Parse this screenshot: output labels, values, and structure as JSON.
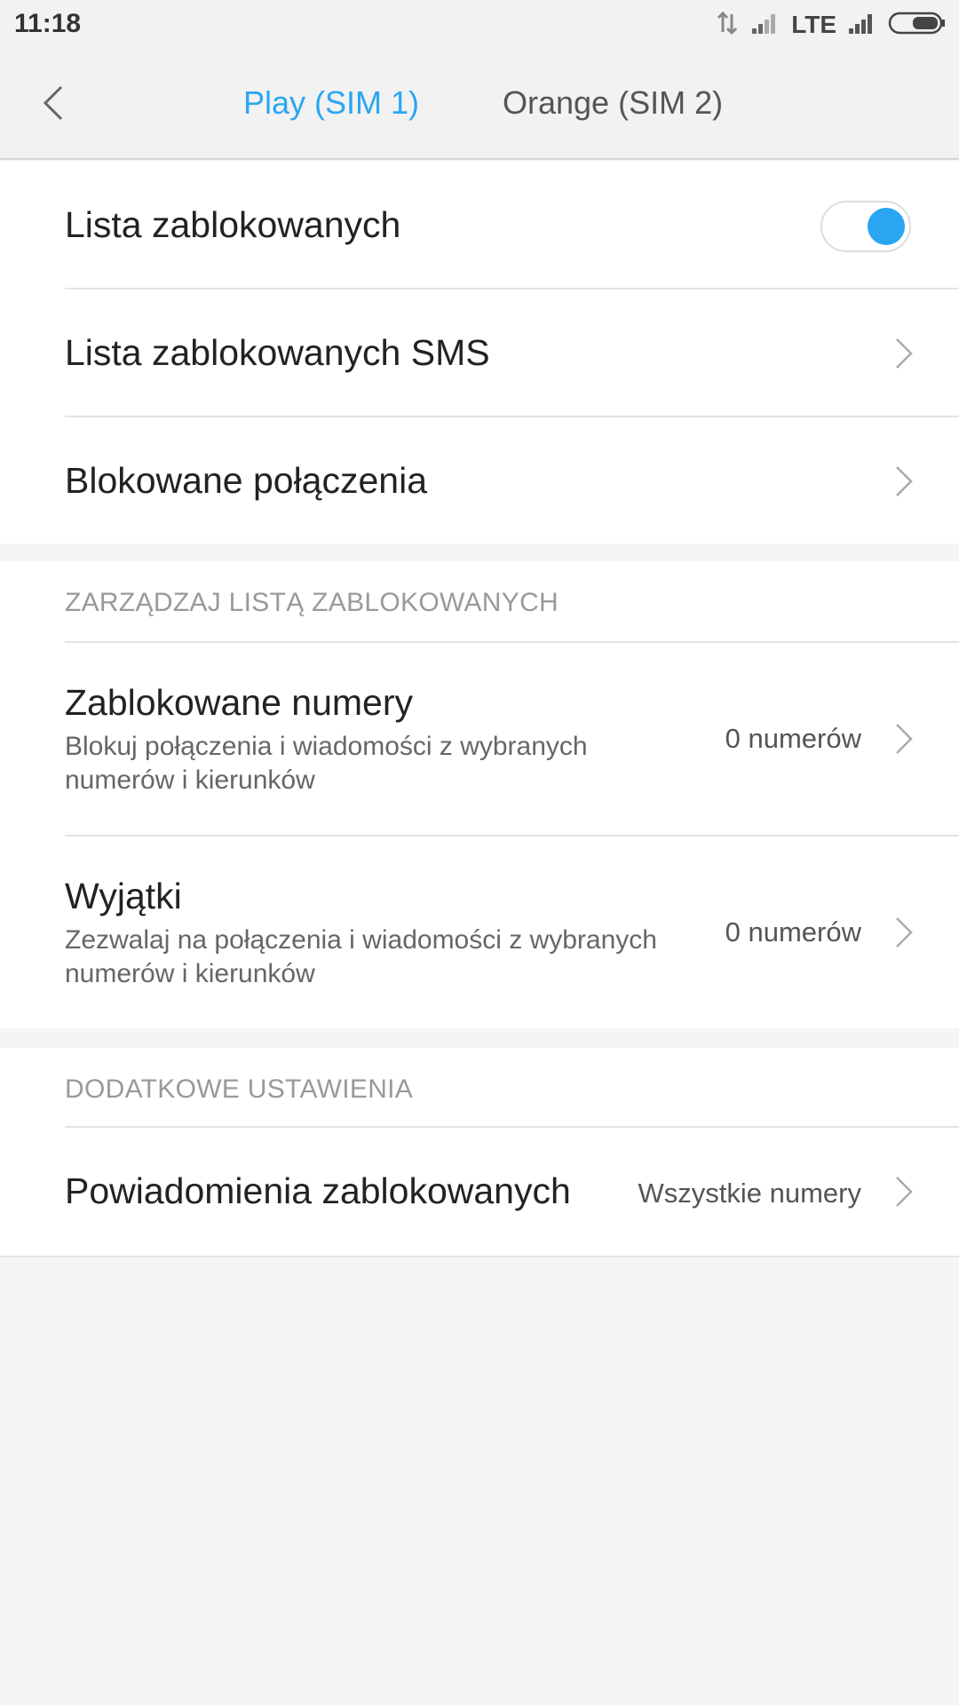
{
  "status_bar": {
    "time": "11:18",
    "network": "LTE",
    "icons": [
      "data-transfer-icon",
      "signal-icon",
      "signal-icon",
      "battery-icon"
    ]
  },
  "header": {
    "back_icon": "chevron-left-icon",
    "tabs": [
      {
        "label": "Play (SIM 1)",
        "active": true
      },
      {
        "label": "Orange (SIM 2)",
        "active": false
      }
    ]
  },
  "colors": {
    "accent": "#2aa6f2",
    "background": "#f5f5f5",
    "card": "#ffffff"
  },
  "main": {
    "rows": [
      {
        "title": "Lista zablokowanych",
        "control": "toggle",
        "toggle_on": true
      },
      {
        "title": "Lista zablokowanych SMS",
        "icon": "chevron-right-icon"
      },
      {
        "title": "Blokowane połączenia",
        "icon": "chevron-right-icon"
      }
    ]
  },
  "manage": {
    "label": "ZARZĄDZAJ LISTĄ ZABLOKOWANYCH",
    "items": [
      {
        "title": "Zablokowane numery",
        "subtitle": "Blokuj połączenia i wiadomości z wybranych numerów i kierunków",
        "value": "0 numerów"
      },
      {
        "title": "Wyjątki",
        "subtitle": "Zezwalaj na połączenia i wiadomości z wybranych numerów i kierunków",
        "value": "0 numerów"
      }
    ]
  },
  "extra": {
    "label": "DODATKOWE USTAWIENIA",
    "items": [
      {
        "title": "Powiadomienia zablokowanych",
        "value": "Wszystkie numery"
      }
    ]
  }
}
